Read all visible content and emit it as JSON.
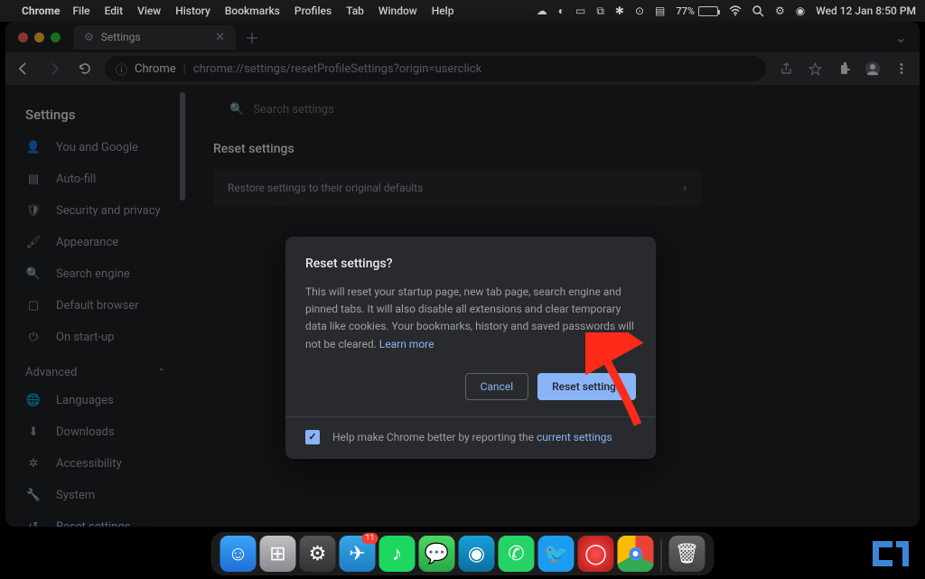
{
  "menubar": {
    "app": "Chrome",
    "items": [
      "File",
      "Edit",
      "View",
      "History",
      "Bookmarks",
      "Profiles",
      "Tab",
      "Window",
      "Help"
    ],
    "battery": "77%",
    "datetime": "Wed 12 Jan  8:50 PM"
  },
  "tab": {
    "title": "Settings"
  },
  "omnibox": {
    "chip": "Chrome",
    "url": "chrome://settings/resetProfileSettings?origin=userclick"
  },
  "settings": {
    "title": "Settings",
    "search_placeholder": "Search settings",
    "nav_main": [
      {
        "icon": "person",
        "label": "You and Google"
      },
      {
        "icon": "autofill",
        "label": "Auto-fill"
      },
      {
        "icon": "shield",
        "label": "Security and privacy"
      },
      {
        "icon": "brush",
        "label": "Appearance"
      },
      {
        "icon": "search",
        "label": "Search engine"
      },
      {
        "icon": "browser",
        "label": "Default browser"
      },
      {
        "icon": "power",
        "label": "On start-up"
      }
    ],
    "advanced_label": "Advanced",
    "nav_adv": [
      {
        "icon": "globe",
        "label": "Languages"
      },
      {
        "icon": "download",
        "label": "Downloads"
      },
      {
        "icon": "accessibility",
        "label": "Accessibility"
      },
      {
        "icon": "wrench",
        "label": "System"
      },
      {
        "icon": "reset",
        "label": "Reset settings",
        "active": true
      }
    ],
    "section_title": "Reset settings",
    "row_label": "Restore settings to their original defaults"
  },
  "dialog": {
    "title": "Reset settings?",
    "body": "This will reset your startup page, new tab page, search engine and pinned tabs. It will also disable all extensions and clear temporary data like cookies. Your bookmarks, history and saved passwords will not be cleared. ",
    "learn_more": "Learn more",
    "cancel": "Cancel",
    "confirm": "Reset settings",
    "footer_text": "Help make Chrome better by reporting the ",
    "footer_link": "current settings",
    "checked": true
  },
  "dock": {
    "telegram_badge": "11"
  }
}
